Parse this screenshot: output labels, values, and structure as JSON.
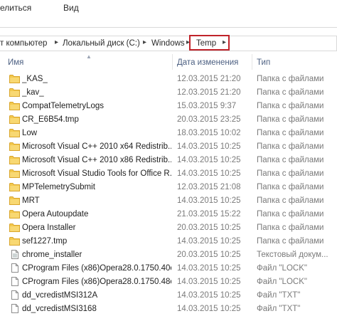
{
  "ribbon": {
    "tab_share": "елиться",
    "tab_view": "Вид"
  },
  "breadcrumb": {
    "items": [
      "т компьютер",
      "Локальный диск (C:)",
      "Windows",
      "Temp"
    ]
  },
  "columns": {
    "name": "Имя",
    "date": "Дата изменения",
    "type": "Тип"
  },
  "files": [
    {
      "name": "_KAS_",
      "date": "12.03.2015 21:20",
      "type": "Папка с файлами",
      "icon": "folder-icon"
    },
    {
      "name": "_kav_",
      "date": "12.03.2015 21:20",
      "type": "Папка с файлами",
      "icon": "folder-icon"
    },
    {
      "name": "CompatTelemetryLogs",
      "date": "15.03.2015 9:37",
      "type": "Папка с файлами",
      "icon": "folder-icon"
    },
    {
      "name": "CR_E6B54.tmp",
      "date": "20.03.2015 23:25",
      "type": "Папка с файлами",
      "icon": "folder-icon"
    },
    {
      "name": "Low",
      "date": "18.03.2015 10:02",
      "type": "Папка с файлами",
      "icon": "folder-icon"
    },
    {
      "name": "Microsoft Visual C++ 2010  x64 Redistrib...",
      "date": "14.03.2015 10:25",
      "type": "Папка с файлами",
      "icon": "folder-icon"
    },
    {
      "name": "Microsoft Visual C++ 2010  x86 Redistrib...",
      "date": "14.03.2015 10:25",
      "type": "Папка с файлами",
      "icon": "folder-icon"
    },
    {
      "name": "Microsoft Visual Studio Tools for Office R...",
      "date": "14.03.2015 10:25",
      "type": "Папка с файлами",
      "icon": "folder-icon"
    },
    {
      "name": "MPTelemetrySubmit",
      "date": "12.03.2015 21:08",
      "type": "Папка с файлами",
      "icon": "folder-icon"
    },
    {
      "name": "MRT",
      "date": "14.03.2015 10:25",
      "type": "Папка с файлами",
      "icon": "folder-icon"
    },
    {
      "name": "Opera Autoupdate",
      "date": "21.03.2015 15:22",
      "type": "Папка с файлами",
      "icon": "folder-icon"
    },
    {
      "name": "Opera Installer",
      "date": "20.03.2015 10:25",
      "type": "Папка с файлами",
      "icon": "folder-icon"
    },
    {
      "name": "sef1227.tmp",
      "date": "14.03.2015 10:25",
      "type": "Папка с файлами",
      "icon": "folder-icon"
    },
    {
      "name": "chrome_installer",
      "date": "20.03.2015 10:25",
      "type": "Текстовый докум...",
      "icon": "text-document-icon"
    },
    {
      "name": "CProgram Files (x86)Opera28.0.1750.40op...",
      "date": "14.03.2015 10:25",
      "type": "Файл \"LOCK\"",
      "icon": "file-icon"
    },
    {
      "name": "CProgram Files (x86)Opera28.0.1750.48op...",
      "date": "14.03.2015 10:25",
      "type": "Файл \"LOCK\"",
      "icon": "file-icon"
    },
    {
      "name": "dd_vcredistMSI312A",
      "date": "14.03.2015 10:25",
      "type": "Файл \"TXT\"",
      "icon": "file-icon"
    },
    {
      "name": "dd_vcredistMSI3168",
      "date": "14.03.2015 10:25",
      "type": "Файл \"TXT\"",
      "icon": "file-icon"
    }
  ]
}
